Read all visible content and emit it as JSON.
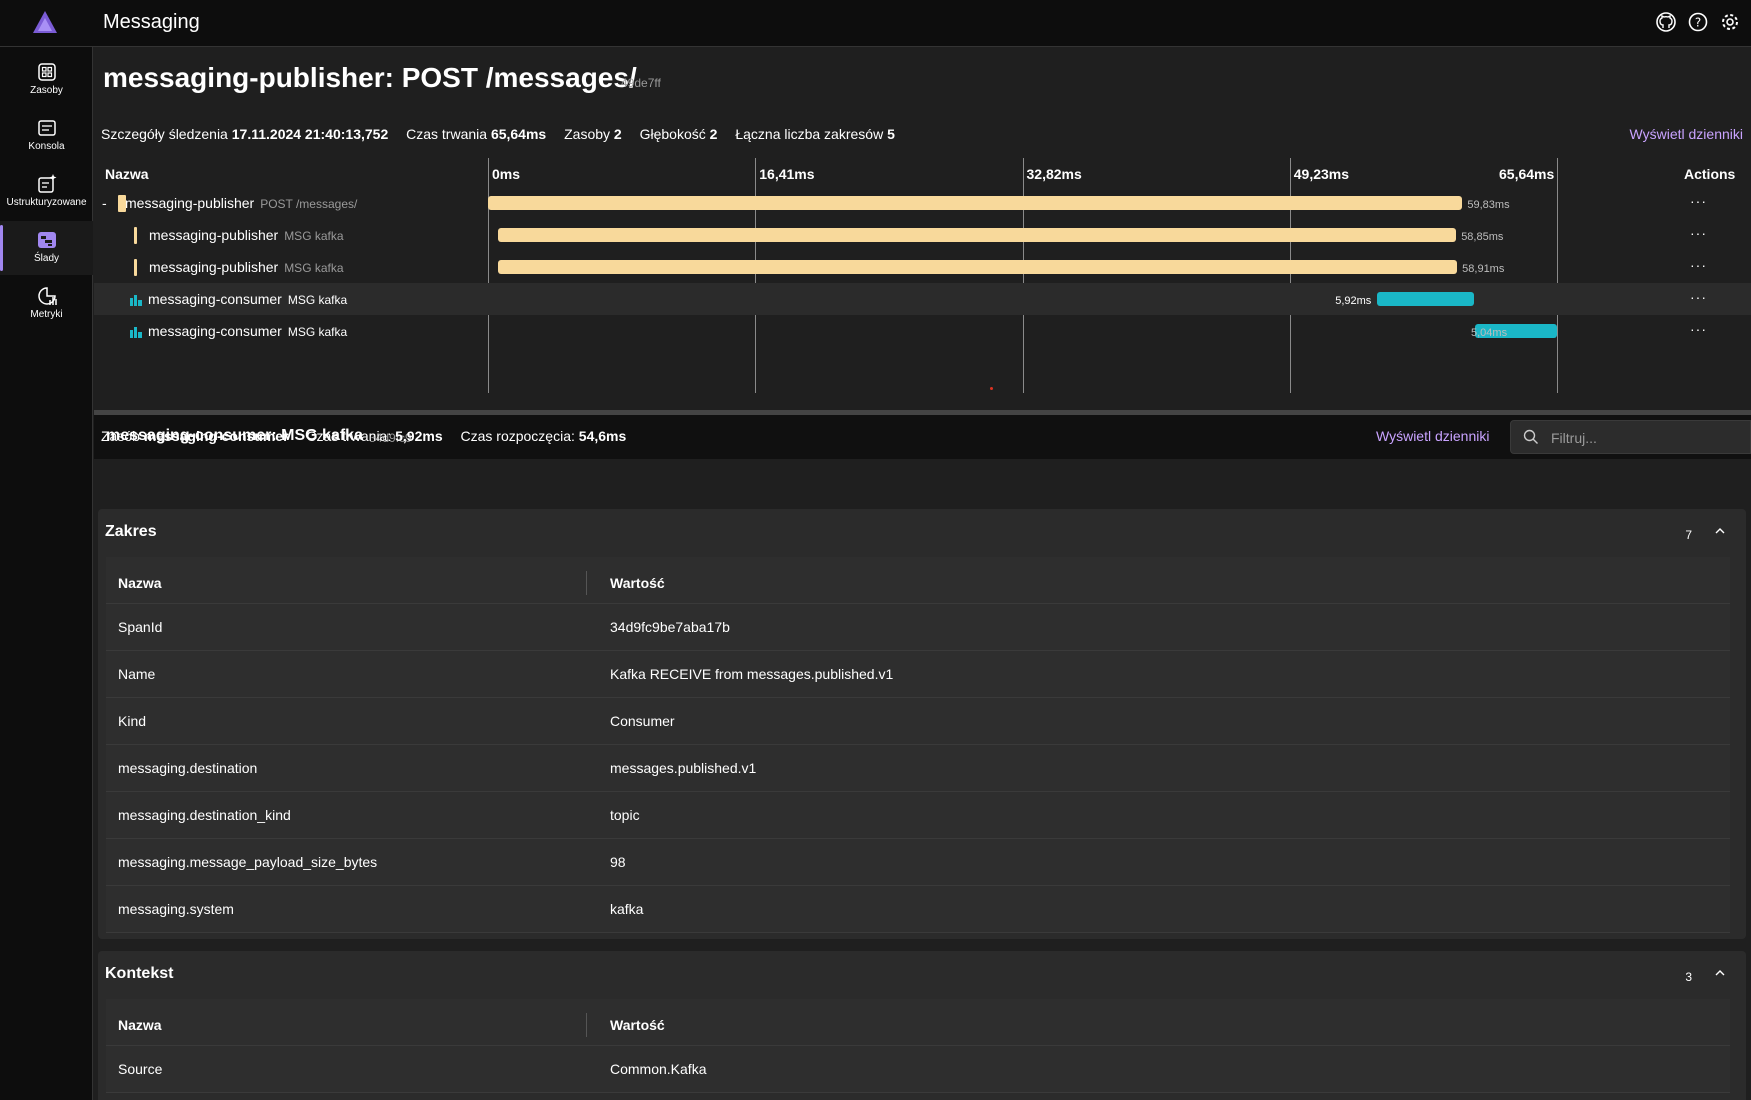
{
  "app": {
    "title": "Messaging"
  },
  "sidebar": {
    "items": [
      {
        "label": "Zasoby",
        "icon": "grid-icon"
      },
      {
        "label": "Konsola",
        "icon": "console-icon"
      },
      {
        "label": "Ustrukturyzowane",
        "icon": "structured-logs-icon"
      },
      {
        "label": "Ślady",
        "icon": "traces-icon",
        "active": true
      },
      {
        "label": "Metryki",
        "icon": "metrics-icon"
      }
    ]
  },
  "trace": {
    "title": "messaging-publisher: POST /messages/",
    "id": "49de7ff",
    "details_label": "Szczegóły śledzenia",
    "details_value": "17.11.2024 21:40:13,752",
    "duration_label": "Czas trwania",
    "duration_value": "65,64ms",
    "resources_label": "Zasoby",
    "resources_value": "2",
    "depth_label": "Głębokość",
    "depth_value": "2",
    "spans_label": "Łączna liczba zakresów",
    "spans_value": "5",
    "view_logs": "Wyświetl dzienniki"
  },
  "grid": {
    "name_header": "Nazwa",
    "ticks": [
      "0ms",
      "16,41ms",
      "32,82ms",
      "49,23ms",
      "65,64ms"
    ],
    "actions_header": "Actions",
    "total_ms": 65.64,
    "rows": [
      {
        "name": "messaging-publisher",
        "sub": "POST /messages/",
        "collapse": "-",
        "start_ms": 0,
        "duration_ms": 59.83,
        "duration_label": "59,83ms",
        "kind": "publisher",
        "actions": "···"
      },
      {
        "name": "messaging-publisher",
        "sub": "MSG kafka",
        "start_ms": 0.6,
        "duration_ms": 58.85,
        "duration_label": "58,85ms",
        "kind": "publisher",
        "actions": "···"
      },
      {
        "name": "messaging-publisher",
        "sub": "MSG kafka",
        "start_ms": 0.6,
        "duration_ms": 58.91,
        "duration_label": "58,91ms",
        "kind": "publisher",
        "actions": "···"
      },
      {
        "name": "messaging-consumer",
        "sub": "MSG kafka",
        "start_ms": 54.6,
        "duration_ms": 5.92,
        "duration_label": "5,92ms",
        "kind": "consumer",
        "actions": "···",
        "selected": true
      },
      {
        "name": "messaging-consumer",
        "sub": "MSG kafka",
        "start_ms": 60.6,
        "duration_ms": 5.04,
        "duration_label": "5,04ms",
        "kind": "consumer",
        "actions": "···"
      }
    ],
    "colors": {
      "publisher": "#f8d99b",
      "consumer": "#1ab7c7"
    }
  },
  "detail": {
    "title": "messaging-consumer: MSG kafka",
    "id": "34d9fc9",
    "resource_label": "Zasób",
    "resource_value": "messaging-consumer",
    "duration_label": "Czas trwania:",
    "duration_value": "5,92ms",
    "start_label": "Czas rozpoczęcia:",
    "start_value": "54,6ms",
    "view_logs": "Wyświetl dzienniki",
    "filter_placeholder": "Filtruj..."
  },
  "sections": {
    "span": {
      "title": "Zakres",
      "count": "7",
      "name_header": "Nazwa",
      "value_header": "Wartość",
      "rows": [
        {
          "k": "SpanId",
          "v": "34d9fc9be7aba17b"
        },
        {
          "k": "Name",
          "v": "Kafka RECEIVE from messages.published.v1"
        },
        {
          "k": "Kind",
          "v": "Consumer"
        },
        {
          "k": "messaging.destination",
          "v": "messages.published.v1"
        },
        {
          "k": "messaging.destination_kind",
          "v": "topic"
        },
        {
          "k": "messaging.message_payload_size_bytes",
          "v": "98"
        },
        {
          "k": "messaging.system",
          "v": "kafka"
        }
      ]
    },
    "context": {
      "title": "Kontekst",
      "count": "3",
      "name_header": "Nazwa",
      "value_header": "Wartość",
      "rows": [
        {
          "k": "Source",
          "v": "Common.Kafka"
        }
      ]
    }
  }
}
